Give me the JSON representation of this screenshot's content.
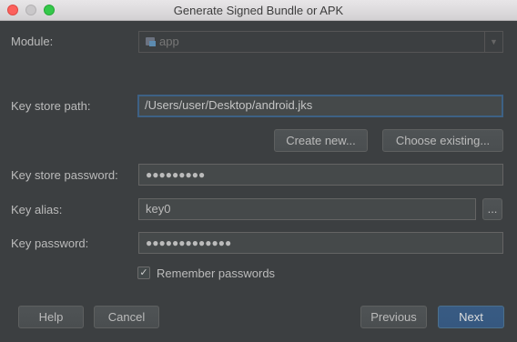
{
  "window": {
    "title": "Generate Signed Bundle or APK"
  },
  "module": {
    "label": "Module:",
    "value": "app",
    "icon": "folder-module-icon",
    "enabled": false
  },
  "key_store_path": {
    "label": "Key store path:",
    "value": "/Users/user/Desktop/android.jks"
  },
  "buttons": {
    "create_new": "Create new...",
    "choose_existing": "Choose existing...",
    "browse": "...",
    "help": "Help",
    "cancel": "Cancel",
    "previous": "Previous",
    "next": "Next"
  },
  "key_store_password": {
    "label": "Key store password:",
    "masked_value": "●●●●●●●●●"
  },
  "key_alias": {
    "label": "Key alias:",
    "value": "key0"
  },
  "key_password": {
    "label": "Key password:",
    "masked_value": "●●●●●●●●●●●●●"
  },
  "remember_passwords": {
    "label": "Remember passwords",
    "checked": true,
    "check_glyph": "✓"
  },
  "colors": {
    "background": "#3c3f41",
    "field_background": "#45494a",
    "focus_border": "#3d6185",
    "primary_button": "#365880",
    "text": "#bbbbbb"
  }
}
